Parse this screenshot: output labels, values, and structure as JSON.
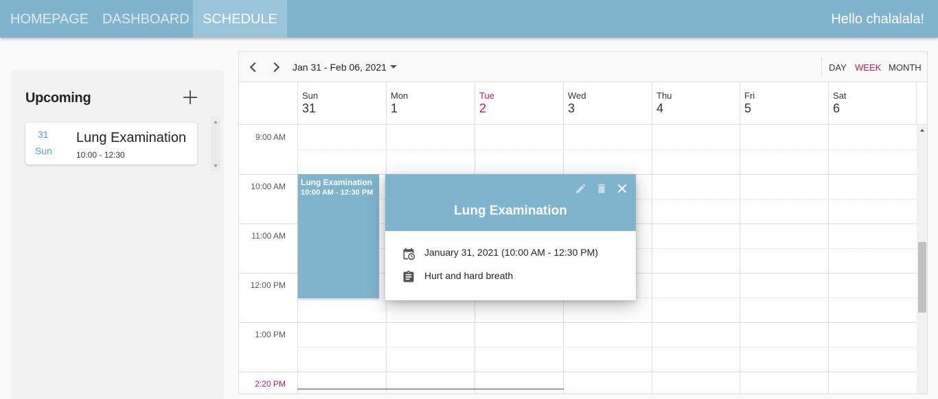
{
  "nav": {
    "items": [
      {
        "label": "HOMEPAGE",
        "active": false
      },
      {
        "label": "DASHBOARD",
        "active": false
      },
      {
        "label": "SCHEDULE",
        "active": true
      }
    ],
    "greeting": "Hello chalalala!"
  },
  "upcoming": {
    "title": "Upcoming",
    "add_icon": "plus-icon",
    "events": [
      {
        "day": "31",
        "dow": "Sun",
        "title": "Lung Examination",
        "time": "10:00 - 12:30"
      }
    ]
  },
  "scheduler": {
    "range_label": "Jan 31 - Feb 06, 2021",
    "views": [
      "DAY",
      "WEEK",
      "MONTH"
    ],
    "active_view": "WEEK",
    "days": [
      {
        "dow": "Sun",
        "num": "31"
      },
      {
        "dow": "Mon",
        "num": "1"
      },
      {
        "dow": "Tue",
        "num": "2",
        "today": true
      },
      {
        "dow": "Wed",
        "num": "3"
      },
      {
        "dow": "Thu",
        "num": "4"
      },
      {
        "dow": "Fri",
        "num": "5"
      },
      {
        "dow": "Sat",
        "num": "6"
      }
    ],
    "time_labels": [
      "9:00 AM",
      "10:00 AM",
      "11:00 AM",
      "12:00 PM",
      "1:00 PM",
      "2:20 PM"
    ],
    "appointment": {
      "title": "Lung Examination",
      "time": "10:00 AM - 12:30 PM"
    }
  },
  "tooltip": {
    "title": "Lung Examination",
    "date_text": "January 31, 2021 (10:00 AM - 12:30 PM)",
    "notes_text": "Hurt and hard breath",
    "icons": [
      "edit-icon",
      "delete-icon",
      "close-icon",
      "calendar-clock-icon",
      "clipboard-icon"
    ]
  },
  "colors": {
    "primary": "#80b3cc",
    "accent": "#c2185b"
  }
}
